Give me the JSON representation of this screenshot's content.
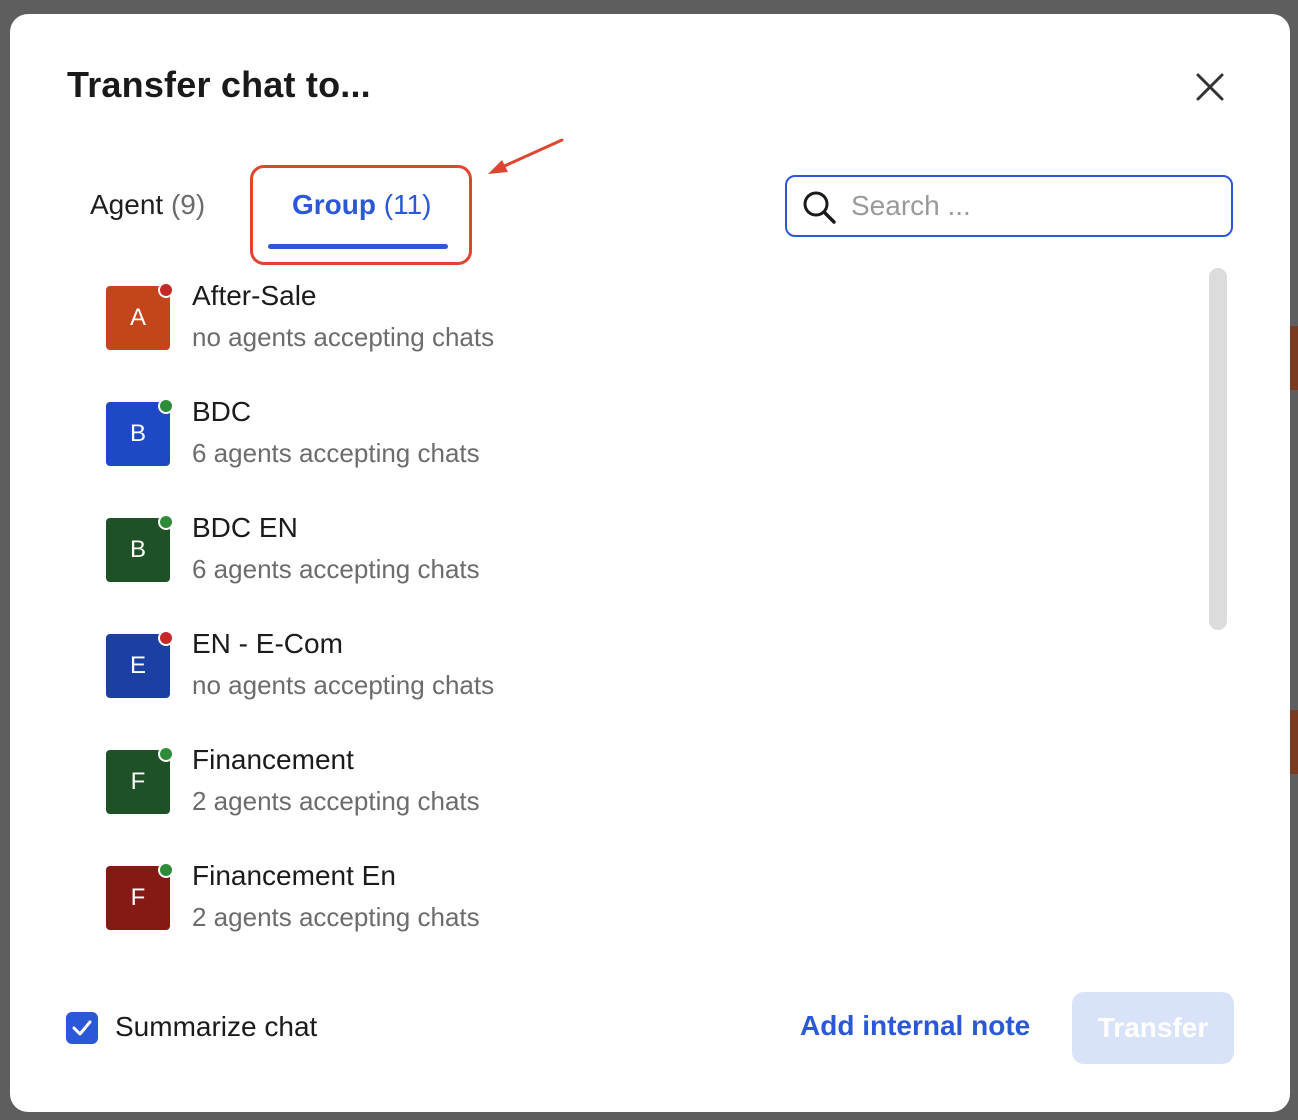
{
  "dialog": {
    "title": "Transfer chat to...",
    "close_icon": "close-icon"
  },
  "tabs": {
    "agent": {
      "label": "Agent",
      "count": "(9)"
    },
    "group": {
      "label": "Group",
      "count": "(11)",
      "active": true
    }
  },
  "search": {
    "placeholder": "Search ...",
    "value": "",
    "icon": "search-icon"
  },
  "groups": [
    {
      "initial": "A",
      "name": "After-Sale",
      "status_text": "no agents accepting chats",
      "avatar_color": "#c2451c",
      "status_color": "#c62828"
    },
    {
      "initial": "B",
      "name": "BDC",
      "status_text": "6 agents accepting chats",
      "avatar_color": "#1f49c4",
      "status_color": "#2e8b3a"
    },
    {
      "initial": "B",
      "name": "BDC EN",
      "status_text": "6 agents accepting chats",
      "avatar_color": "#1e5126",
      "status_color": "#2e8b3a"
    },
    {
      "initial": "E",
      "name": "EN - E-Com",
      "status_text": "no agents accepting chats",
      "avatar_color": "#1c3fa3",
      "status_color": "#c62828"
    },
    {
      "initial": "F",
      "name": "Financement",
      "status_text": "2 agents accepting chats",
      "avatar_color": "#1e5126",
      "status_color": "#2e8b3a"
    },
    {
      "initial": "F",
      "name": "Financement En",
      "status_text": "2 agents accepting chats",
      "avatar_color": "#851913",
      "status_color": "#2e8b3a"
    }
  ],
  "footer": {
    "summarize_label": "Summarize chat",
    "summarize_checked": true,
    "add_note_label": "Add internal note",
    "transfer_label": "Transfer",
    "transfer_disabled": true
  },
  "colors": {
    "accent": "#2a58d6",
    "annotation": "#e0452f",
    "transfer_disabled_bg": "#d8e2f8"
  }
}
